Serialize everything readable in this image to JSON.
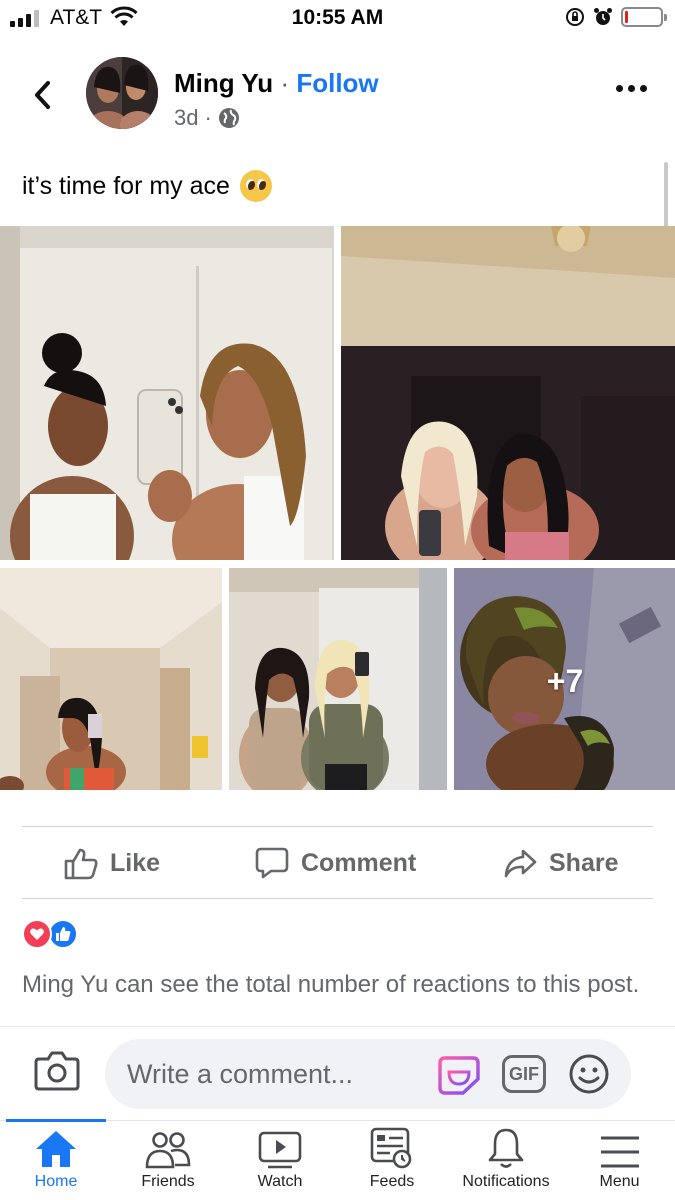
{
  "status_bar": {
    "carrier": "AT&T",
    "time": "10:55 AM"
  },
  "post": {
    "author": "Ming Yu",
    "separator": "·",
    "follow_label": "Follow",
    "age": "3d",
    "meta_separator": "·",
    "privacy_icon": "globe-icon",
    "caption": "it’s time for my ace",
    "caption_emoji": "pleading-face-emoji",
    "photos": [
      {
        "id": "photo-1"
      },
      {
        "id": "photo-2"
      },
      {
        "id": "photo-3"
      },
      {
        "id": "photo-4"
      },
      {
        "id": "photo-5",
        "overlay": "+7"
      }
    ]
  },
  "actions": {
    "like": "Like",
    "comment": "Comment",
    "share": "Share"
  },
  "reactions": {
    "icons": [
      "love-reaction-icon",
      "like-reaction-icon"
    ]
  },
  "notice": "Ming Yu can see the total number of reactions to this post.",
  "comment_bar": {
    "placeholder": "Write a comment...",
    "gif_label": "GIF"
  },
  "nav": {
    "items": [
      {
        "label": "Home",
        "icon": "home-icon",
        "active": true
      },
      {
        "label": "Friends",
        "icon": "friends-icon"
      },
      {
        "label": "Watch",
        "icon": "watch-icon"
      },
      {
        "label": "Feeds",
        "icon": "feeds-icon"
      },
      {
        "label": "Notifications",
        "icon": "bell-icon"
      },
      {
        "label": "Menu",
        "icon": "menu-icon"
      }
    ]
  },
  "colors": {
    "accent": "#1877f2",
    "secondary_text": "#65676b",
    "love": "#f33e58"
  }
}
